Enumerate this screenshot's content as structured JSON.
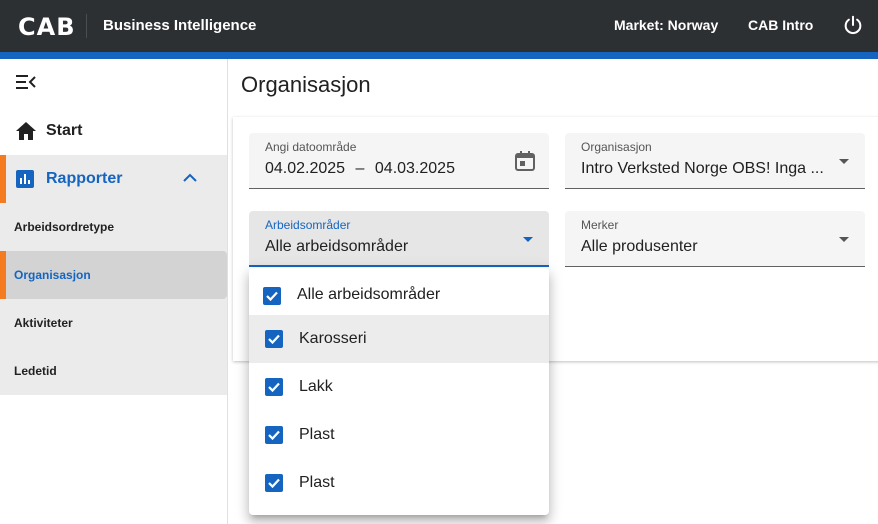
{
  "header": {
    "logo": "CAB",
    "app_title": "Business Intelligence",
    "market": "Market: Norway",
    "user": "CAB Intro"
  },
  "colors": {
    "header_bg": "#2d3033",
    "brand_blue": "#1565c0",
    "accent_orange": "#f47b20"
  },
  "sidebar": {
    "start_label": "Start",
    "group_label": "Rapporter",
    "items": [
      {
        "label": "Arbeidsordretype",
        "active": false
      },
      {
        "label": "Organisasjon",
        "active": true
      },
      {
        "label": "Aktiviteter",
        "active": false
      },
      {
        "label": "Ledetid",
        "active": false
      }
    ]
  },
  "main": {
    "page_title": "Organisasjon",
    "date_field": {
      "label": "Angi datoområde",
      "start": "04.02.2025",
      "separator": "–",
      "end": "04.03.2025"
    },
    "org_field": {
      "label": "Organisasjon",
      "value": "Intro Verksted Norge OBS! Inga ..."
    },
    "area_field": {
      "label": "Arbeidsområder",
      "value": "Alle arbeidsområder"
    },
    "brand_field": {
      "label": "Merker",
      "value": "Alle produsenter"
    }
  },
  "dropdown": {
    "options": [
      {
        "label": "Alle arbeidsområder",
        "checked": true
      },
      {
        "label": "Karosseri",
        "checked": true
      },
      {
        "label": "Lakk",
        "checked": true
      },
      {
        "label": "Plast",
        "checked": true
      },
      {
        "label": "Plast",
        "checked": true
      }
    ]
  }
}
